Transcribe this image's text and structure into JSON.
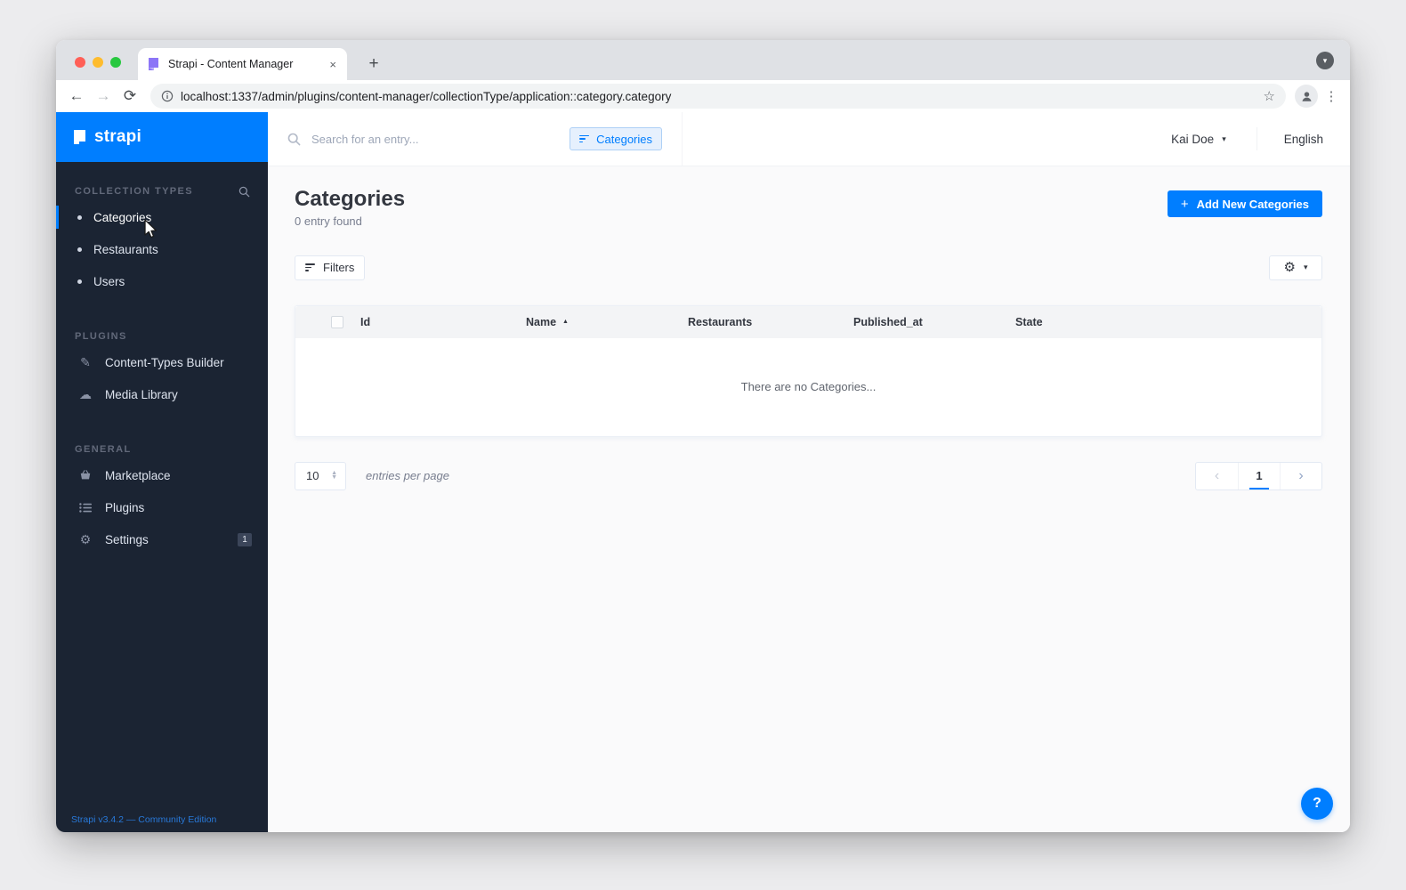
{
  "browser": {
    "tab_title": "Strapi - Content Manager",
    "url": "localhost:1337/admin/plugins/content-manager/collectionType/application::category.category"
  },
  "icons": {
    "close_tab": "×",
    "new_tab": "+",
    "back": "←",
    "forward": "→",
    "reload": "⟳",
    "star": "☆",
    "menu_dots": "⋮",
    "caret_down": "▾",
    "sort_asc": "▲",
    "plus": "+",
    "prev": "‹",
    "next": "›",
    "gear": "⚙",
    "cloud": "☁",
    "brush": "✎",
    "spin_up": "▲",
    "spin_down": "▼",
    "question": "?"
  },
  "appbar": {
    "search_placeholder": "Search for an entry...",
    "filter_chip_label": "Categories",
    "user_name": "Kai Doe",
    "language": "English"
  },
  "sidebar": {
    "logo_text": "strapi",
    "sections": [
      {
        "title": "COLLECTION TYPES",
        "items": [
          {
            "label": "Categories"
          },
          {
            "label": "Restaurants"
          },
          {
            "label": "Users"
          }
        ]
      },
      {
        "title": "PLUGINS",
        "items": [
          {
            "label": "Content-Types Builder"
          },
          {
            "label": "Media Library"
          }
        ]
      },
      {
        "title": "GENERAL",
        "items": [
          {
            "label": "Marketplace"
          },
          {
            "label": "Plugins"
          },
          {
            "label": "Settings",
            "badge": "1"
          }
        ]
      }
    ],
    "footer": "Strapi v3.4.2 — Community Edition"
  },
  "main": {
    "title": "Categories",
    "subtitle": "0 entry found",
    "add_button_label": "Add New Categories",
    "filters_button_label": "Filters",
    "table": {
      "columns": [
        "Id",
        "Name",
        "Restaurants",
        "Published_at",
        "State"
      ],
      "empty_message": "There are no Categories..."
    },
    "pagination": {
      "per_page": "10",
      "per_page_label": "entries per page",
      "current_page": "1"
    }
  },
  "colors": {
    "primary": "#007EFF",
    "sidebar_bg": "#1B2433",
    "main_bg": "#FAFAFB",
    "favicon_purple": "#8C75F7"
  }
}
